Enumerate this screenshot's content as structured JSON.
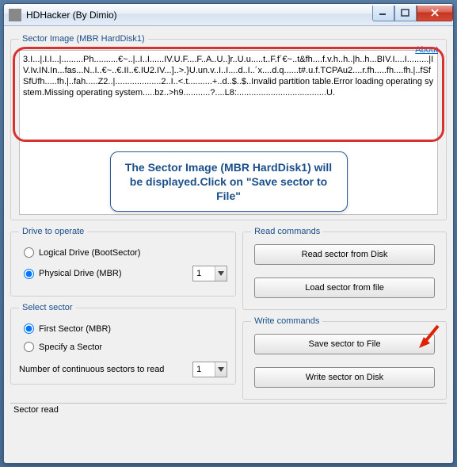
{
  "title": "HDHacker (By Dimio)",
  "sectorImage": {
    "legend": "Sector Image (MBR HardDisk1)",
    "about": "About",
    "content": "3.I...|.I.I...|.........Ph..........€~..|..I..I......IV.U.F....F..A..U..]r..U.u.....t..F.f´€~..t&fh....f.v.h..h..|h..h...BIV.I....I.........|IV.Iv.IN.In...fas...N..I..€~..€.II..€.IU2.IV...]..>.}U.un.v..I..I....d..I..´x....d.q......t#.u.f.TCPAu2....r.fh.....fh....fh.|..fSfSfUfh.....fh.|..fah.....Z2..|...................2..I..<.t..........+..d..$..$..Invalid partition table.Error loading operating system.Missing operating system.....bz..>h9...........?....L8:.....................................U."
  },
  "callout": "The Sector Image (MBR HardDisk1) will be displayed.Click on \"Save sector to File\"",
  "drive": {
    "legend": "Drive to operate",
    "logical": "Logical Drive (BootSector)",
    "physical": "Physical Drive (MBR)",
    "combo": "1"
  },
  "select": {
    "legend": "Select sector",
    "first": "First Sector (MBR)",
    "specify": "Specify a Sector",
    "numlabel": "Number of continuous sectors to read",
    "combo": "1"
  },
  "read": {
    "legend": "Read commands",
    "btn1": "Read sector from Disk",
    "btn2": "Load sector from file"
  },
  "write": {
    "legend": "Write commands",
    "btn1": "Save sector to File",
    "btn2": "Write sector on Disk"
  },
  "status": "Sector read"
}
